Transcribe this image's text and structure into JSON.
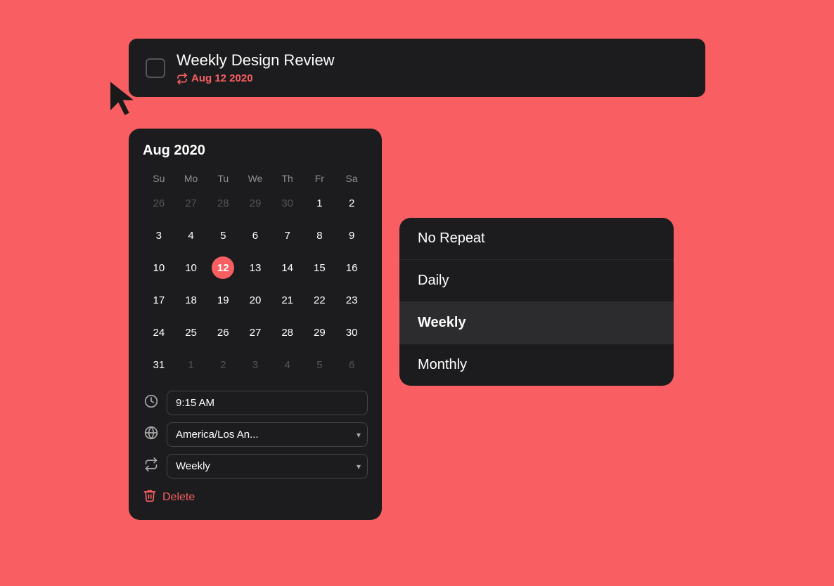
{
  "background_color": "#f95f62",
  "task": {
    "title": "Weekly Design Review",
    "date_label": "Aug 12 2020",
    "checkbox_label": "task-checkbox"
  },
  "calendar": {
    "month_title": "Aug 2020",
    "day_headers": [
      "Su",
      "Mo",
      "Tu",
      "We",
      "Th",
      "Fr",
      "Sa"
    ],
    "weeks": [
      [
        "26",
        "27",
        "28",
        "29",
        "30",
        "1",
        "2"
      ],
      [
        "3",
        "4",
        "5",
        "6",
        "7",
        "8",
        "9"
      ],
      [
        "10",
        "10",
        "12",
        "13",
        "14",
        "15",
        "16"
      ],
      [
        "17",
        "18",
        "19",
        "20",
        "21",
        "22",
        "23"
      ],
      [
        "24",
        "25",
        "26",
        "27",
        "28",
        "29",
        "30"
      ],
      [
        "31",
        "1",
        "2",
        "3",
        "4",
        "5",
        "6"
      ]
    ],
    "other_month_days": [
      "26",
      "27",
      "28",
      "29",
      "30",
      "1",
      "2",
      "3",
      "4",
      "5",
      "6"
    ],
    "selected_day": "12",
    "time_value": "9:15 AM",
    "timezone_value": "America/Los An...",
    "repeat_value": "Weekly"
  },
  "repeat_menu": {
    "options": [
      {
        "label": "No Repeat",
        "active": false
      },
      {
        "label": "Daily",
        "active": false
      },
      {
        "label": "Weekly",
        "active": true
      },
      {
        "label": "Monthly",
        "active": false
      }
    ]
  },
  "delete_label": "Delete",
  "icons": {
    "clock": "🕐",
    "globe": "🌐",
    "repeat": "↺",
    "trash": "🗑",
    "chevron_down": "⌄",
    "repeat_date": "↺"
  }
}
